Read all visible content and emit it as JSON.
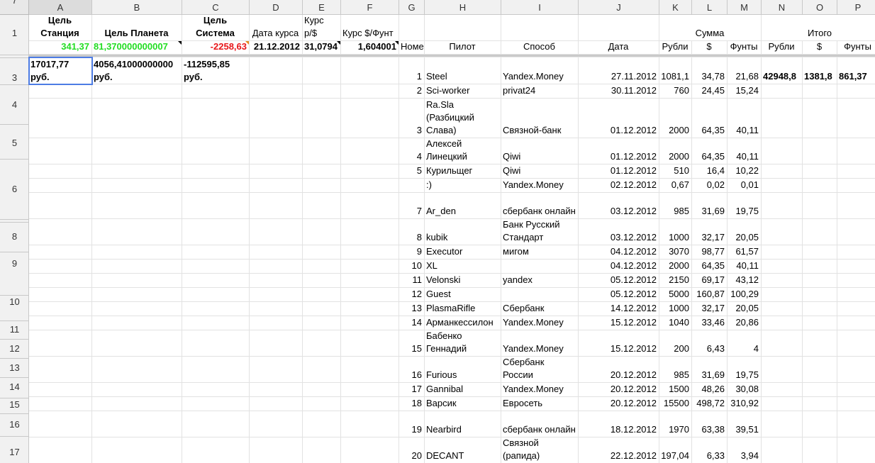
{
  "columns": [
    "A",
    "B",
    "C",
    "D",
    "E",
    "F",
    "G",
    "H",
    "I",
    "J",
    "K",
    "L",
    "M",
    "N",
    "O",
    "P"
  ],
  "row_numbers": [
    "1",
    "",
    "3",
    "4",
    "5",
    "6",
    "7",
    "8",
    "9",
    "10",
    "11",
    "12",
    "13",
    "14",
    "15",
    "16",
    "17"
  ],
  "header": {
    "A1": "Цель Станция",
    "B1": "Цель Планета",
    "C1": "Цель Система",
    "D1": "Дата курса",
    "E1": "Курс р/$",
    "F1": "Курс $/Фунт",
    "sum_label": "Сумма",
    "total_label": "Итого",
    "A2": "341,37",
    "B2": "81,370000000007",
    "C2": "-2258,63",
    "D2": "21.12.2012",
    "E2": "31,0794",
    "F2": "1,604001",
    "G2": "Номе",
    "H2": "Пилот",
    "I2": "Способ",
    "J2": "Дата",
    "K2": "Рубли",
    "L2": "$",
    "M2": "Фунты",
    "N2": "Рубли",
    "O2": "$",
    "P2": "Фунты"
  },
  "row3": {
    "A": "17017,77 руб.",
    "B": "4056,41000000000 руб.",
    "C": "-112595,85 руб.",
    "N": "42948,8",
    "O": "1381,8",
    "P": "861,37"
  },
  "donations": [
    {
      "n": "1",
      "pilot": "Steel",
      "method": "Yandex.Money",
      "date": "27.11.2012",
      "rub": "1081,1",
      "usd": "34,78",
      "gbp": "21,68"
    },
    {
      "n": "2",
      "pilot": "Sci-worker",
      "method": "privat24",
      "date": "30.11.2012",
      "rub": "760",
      "usd": "24,45",
      "gbp": "15,24"
    },
    {
      "n": "3",
      "pilot": "Ra.Sla (Разбицкий Слава)",
      "method": "Связной-банк",
      "date": "01.12.2012",
      "rub": "2000",
      "usd": "64,35",
      "gbp": "40,11"
    },
    {
      "n": "4",
      "pilot": "Adrenalin/Алексей Линецкий",
      "method": "Qiwi",
      "date": "01.12.2012",
      "rub": "2000",
      "usd": "64,35",
      "gbp": "40,11"
    },
    {
      "n": "5",
      "pilot": "Курильщег",
      "method": "Qiwi",
      "date": "01.12.2012",
      "rub": "510",
      "usd": "16,4",
      "gbp": "10,22"
    },
    {
      "n": "",
      "pilot": ":)",
      "method": "Yandex.Money",
      "date": "02.12.2012",
      "rub": "0,67",
      "usd": "0,02",
      "gbp": "0,01"
    },
    {
      "n": "7",
      "pilot": "Ar_den",
      "method": "сбербанк онлайн",
      "date": "03.12.2012",
      "rub": "985",
      "usd": "31,69",
      "gbp": "19,75"
    },
    {
      "n": "8",
      "pilot": "kubik",
      "method": "Банк Русский Стандарт",
      "date": "03.12.2012",
      "rub": "1000",
      "usd": "32,17",
      "gbp": "20,05"
    },
    {
      "n": "9",
      "pilot": "Executor",
      "method": "мигом",
      "date": "04.12.2012",
      "rub": "3070",
      "usd": "98,77",
      "gbp": "61,57"
    },
    {
      "n": "10",
      "pilot": "XL",
      "method": "",
      "date": "04.12.2012",
      "rub": "2000",
      "usd": "64,35",
      "gbp": "40,11"
    },
    {
      "n": "11",
      "pilot": "Velonski",
      "method": "yandex",
      "date": "05.12.2012",
      "rub": "2150",
      "usd": "69,17",
      "gbp": "43,12"
    },
    {
      "n": "12",
      "pilot": "Guest",
      "method": "",
      "date": "05.12.2012",
      "rub": "5000",
      "usd": "160,87",
      "gbp": "100,29"
    },
    {
      "n": "13",
      "pilot": "PlasmaRifle",
      "method": "Сбербанк",
      "date": "14.12.2012",
      "rub": "1000",
      "usd": "32,17",
      "gbp": "20,05"
    },
    {
      "n": "14",
      "pilot": "Арманкессилон",
      "method": "Yandex.Money",
      "date": "15.12.2012",
      "rub": "1040",
      "usd": "33,46",
      "gbp": "20,86"
    },
    {
      "n": "15",
      "pilot": "Бабенко Геннадий",
      "method": "Yandex.Money",
      "date": "15.12.2012",
      "rub": "200",
      "usd": "6,43",
      "gbp": "4"
    },
    {
      "n": "16",
      "pilot": "Furious",
      "method": "Сбербанк России",
      "date": "20.12.2012",
      "rub": "985",
      "usd": "31,69",
      "gbp": "19,75"
    },
    {
      "n": "17",
      "pilot": "Gannibal",
      "method": "Yandex.Money",
      "date": "20.12.2012",
      "rub": "1500",
      "usd": "48,26",
      "gbp": "30,08"
    },
    {
      "n": "18",
      "pilot": "Варсик",
      "method": "Евросеть",
      "date": "20.12.2012",
      "rub": "15500",
      "usd": "498,72",
      "gbp": "310,92"
    },
    {
      "n": "19",
      "pilot": "Nearbird",
      "method": "сбербанк онлайн",
      "date": "18.12.2012",
      "rub": "1970",
      "usd": "63,38",
      "gbp": "39,51"
    },
    {
      "n": "20",
      "pilot": "DECANT",
      "method": "Связной (рапида)",
      "date": "22.12.2012",
      "rub": "197,04",
      "usd": "6,33",
      "gbp": "3,94"
    }
  ],
  "colors": {
    "green": "#22dd22",
    "red": "#e8161a",
    "selection": "#4d7ce4",
    "header_bg": "#f1f1f1"
  }
}
